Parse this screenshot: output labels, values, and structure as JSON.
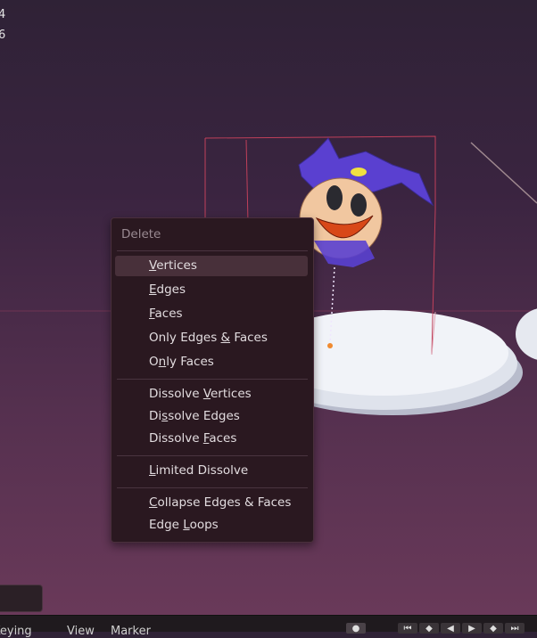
{
  "viewport": {
    "stats": [
      "4",
      "6"
    ]
  },
  "menu": {
    "title": "Delete",
    "groups": [
      [
        {
          "pre": "",
          "ul": "V",
          "post": "ertices",
          "active": true
        },
        {
          "pre": "",
          "ul": "E",
          "post": "dges"
        },
        {
          "pre": "",
          "ul": "F",
          "post": "aces"
        },
        {
          "pre": "Only Edges ",
          "ul": "&",
          "post": " Faces"
        },
        {
          "pre": "O",
          "ul": "n",
          "post": "ly Faces"
        }
      ],
      [
        {
          "pre": "Dissolve ",
          "ul": "V",
          "post": "ertices"
        },
        {
          "pre": "Di",
          "ul": "s",
          "post": "solve Edges"
        },
        {
          "pre": "Dissolve ",
          "ul": "F",
          "post": "aces"
        }
      ],
      [
        {
          "pre": "",
          "ul": "L",
          "post": "imited Dissolve"
        }
      ],
      [
        {
          "pre": "",
          "ul": "C",
          "post": "ollapse Edges & Faces"
        },
        {
          "pre": "Edge ",
          "ul": "L",
          "post": "oops"
        }
      ]
    ]
  },
  "bottom_bar": {
    "keying": "Keying",
    "view": "View",
    "marker": "Marker"
  }
}
